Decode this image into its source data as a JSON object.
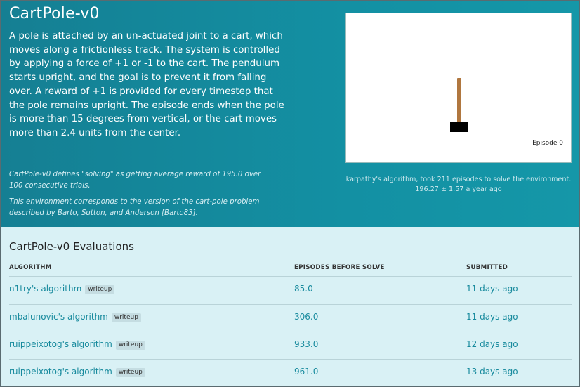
{
  "hero": {
    "title": "CartPole-v0",
    "description": "A pole is attached by an un-actuated joint to a cart, which moves along a frictionless track. The system is controlled by applying a force of +1 or -1 to the cart. The pendulum starts upright, and the goal is to prevent it from falling over. A reward of +1 is provided for every timestep that the pole remains upright. The episode ends when the pole is more than 15 degrees from vertical, or the cart moves more than 2.4 units from the center.",
    "note_solving": "CartPole-v0 defines \"solving\" as getting average reward of 195.0 over 100 consecutive trials.",
    "note_version": "This environment corresponds to the version of the cart-pole problem described by Barto, Sutton, and Anderson [Barto83]."
  },
  "video": {
    "episode_label": "Episode 0",
    "caption_link": "karpathy's algorithm",
    "caption_text": ", took 211 episodes to solve the environment. 196.27 ± 1.57 a year ago"
  },
  "evaluations": {
    "title": "CartPole-v0 Evaluations",
    "columns": [
      "ALGORITHM",
      "EPISODES BEFORE SOLVE",
      "SUBMITTED"
    ],
    "rows": [
      {
        "algorithm": "n1try's algorithm",
        "badge": "writeup",
        "episodes": "85.0",
        "submitted": "11 days ago"
      },
      {
        "algorithm": "mbalunovic's algorithm",
        "badge": "writeup",
        "episodes": "306.0",
        "submitted": "11 days ago"
      },
      {
        "algorithm": "ruippeixotog's algorithm",
        "badge": "writeup",
        "episodes": "933.0",
        "submitted": "12 days ago"
      },
      {
        "algorithm": "ruippeixotog's algorithm",
        "badge": "writeup",
        "episodes": "961.0",
        "submitted": "13 days ago"
      }
    ]
  },
  "colors": {
    "hero_background": "#1390a3",
    "link": "#178a9d",
    "table_background": "#d9f1f5"
  }
}
